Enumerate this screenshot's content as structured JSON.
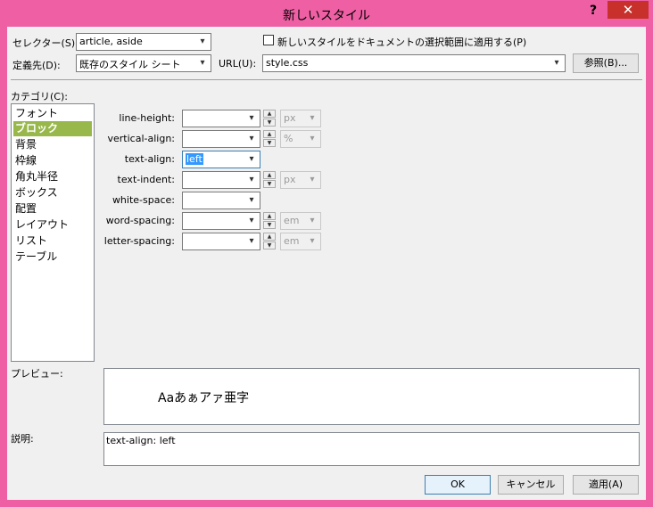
{
  "window": {
    "title": "新しいスタイル",
    "help_label": "?",
    "close_label": "✕"
  },
  "top": {
    "selector_label": "セレクター(S):",
    "selector_value": "article, aside",
    "apply_check_label": "新しいスタイルをドキュメントの選択範囲に適用する(P)",
    "define_label": "定義先(D):",
    "define_value": "既存のスタイル シート",
    "url_label": "URL(U):",
    "url_value": "style.css",
    "browse_label": "参照(B)..."
  },
  "category": {
    "label": "カテゴリ(C):",
    "items": [
      "フォント",
      "ブロック",
      "背景",
      "枠線",
      "角丸半径",
      "ボックス",
      "配置",
      "レイアウト",
      "リスト",
      "テーブル"
    ],
    "selected_index": 1
  },
  "properties": [
    {
      "label": "line-height:",
      "value": "",
      "unit": "px"
    },
    {
      "label": "vertical-align:",
      "value": "",
      "unit": "%"
    },
    {
      "label": "text-align:",
      "value": "left",
      "unit": ""
    },
    {
      "label": "text-indent:",
      "value": "",
      "unit": "px"
    },
    {
      "label": "white-space:",
      "value": "",
      "unit": ""
    },
    {
      "label": "word-spacing:",
      "value": "",
      "unit": "em"
    },
    {
      "label": "letter-spacing:",
      "value": "",
      "unit": "em"
    }
  ],
  "preview": {
    "label": "プレビュー:",
    "sample_text": "Aaあぁアァ亜字"
  },
  "description": {
    "label": "説明:",
    "text": "text-align: left"
  },
  "buttons": {
    "ok": "OK",
    "cancel": "キャンセル",
    "apply": "適用(A)"
  },
  "icons": {
    "dropdown": "▾",
    "spin_up": "▲",
    "spin_down": "▼"
  },
  "colors": {
    "frame": "#ee5fa3",
    "close": "#c7302b",
    "selection": "#99b84b",
    "text_highlight": "#3399ff"
  }
}
